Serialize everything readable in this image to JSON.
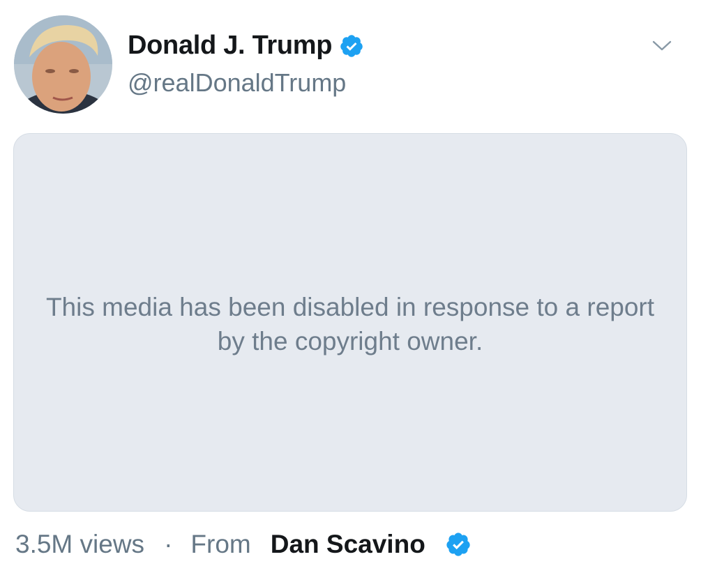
{
  "tweet": {
    "author": {
      "display_name": "Donald J. Trump",
      "handle": "@realDonaldTrump",
      "verified": true,
      "avatar_icon": "profile-photo"
    },
    "menu_icon": "chevron-down-icon",
    "media": {
      "disabled_message": "This media has been disabled in response to a report by the copyright owner."
    },
    "footer": {
      "views": "3.5M views",
      "separator": "·",
      "from_label": "From",
      "source_name": "Dan Scavino",
      "source_verified": true
    }
  },
  "colors": {
    "verified_blue": "#1da1f2",
    "media_background": "#e6eaf0",
    "secondary_text": "#657786",
    "primary_text": "#14171a"
  }
}
